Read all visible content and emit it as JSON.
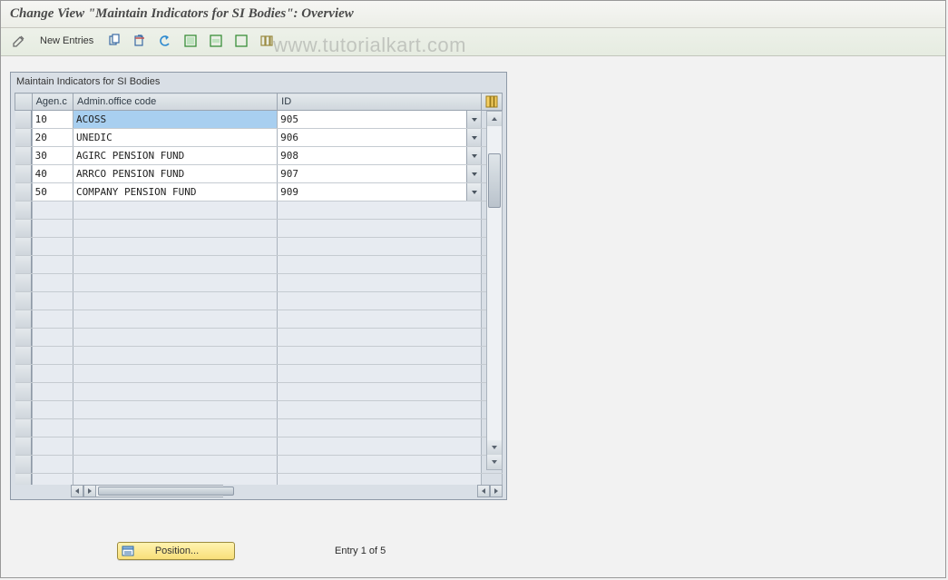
{
  "title": "Change View \"Maintain Indicators for SI Bodies\": Overview",
  "watermark": "www.tutorialkart.com",
  "toolbar": {
    "new_entries_label": "New Entries"
  },
  "panel": {
    "title": "Maintain Indicators for SI Bodies"
  },
  "columns": {
    "agenc": "Agen.c",
    "admin": "Admin.office code",
    "id": "ID"
  },
  "rows": [
    {
      "agenc": "10",
      "admin": "ACOSS",
      "id": "905",
      "selected": true
    },
    {
      "agenc": "20",
      "admin": "UNEDIC",
      "id": "906",
      "selected": false
    },
    {
      "agenc": "30",
      "admin": "AGIRC PENSION FUND",
      "id": "908",
      "selected": false
    },
    {
      "agenc": "40",
      "admin": "ARRCO PENSION FUND",
      "id": "907",
      "selected": false
    },
    {
      "agenc": "50",
      "admin": "COMPANY PENSION FUND",
      "id": "909",
      "selected": false
    }
  ],
  "empty_row_count": 16,
  "footer": {
    "position_label": "Position...",
    "entry_text": "Entry 1 of 5"
  }
}
